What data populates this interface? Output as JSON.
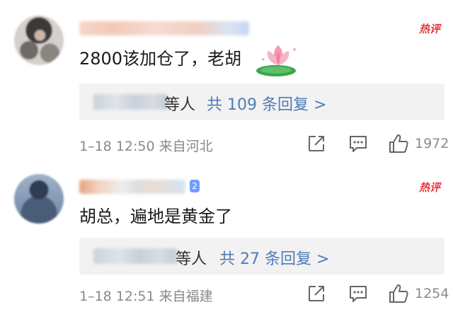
{
  "comments": [
    {
      "text": "2800该加仓了，老胡",
      "hot_label": "热评",
      "reply_etc": "等人",
      "reply_count_label": "共 109 条回复 >",
      "time_location": "1–18 12:50  来自河北",
      "likes": "1972",
      "has_lotus_sticker": true
    },
    {
      "text": "胡总，遍地是黄金了",
      "hot_label": "热评",
      "user_badge": "2",
      "reply_etc": "等人",
      "reply_count_label": "共 27 条回复 >",
      "time_location": "1–18 12:51  来自福建",
      "likes": "1254",
      "has_lotus_sticker": false
    }
  ],
  "colors": {
    "hot": "#e8353c",
    "link": "#4f7bb8",
    "meta": "#8a8a8a",
    "reply_bg": "#f2f2f2"
  },
  "icons": {
    "share": "share-external-icon",
    "reply": "comment-icon",
    "like": "thumbs-up-icon",
    "sticker": "lotus-sticker-icon"
  }
}
